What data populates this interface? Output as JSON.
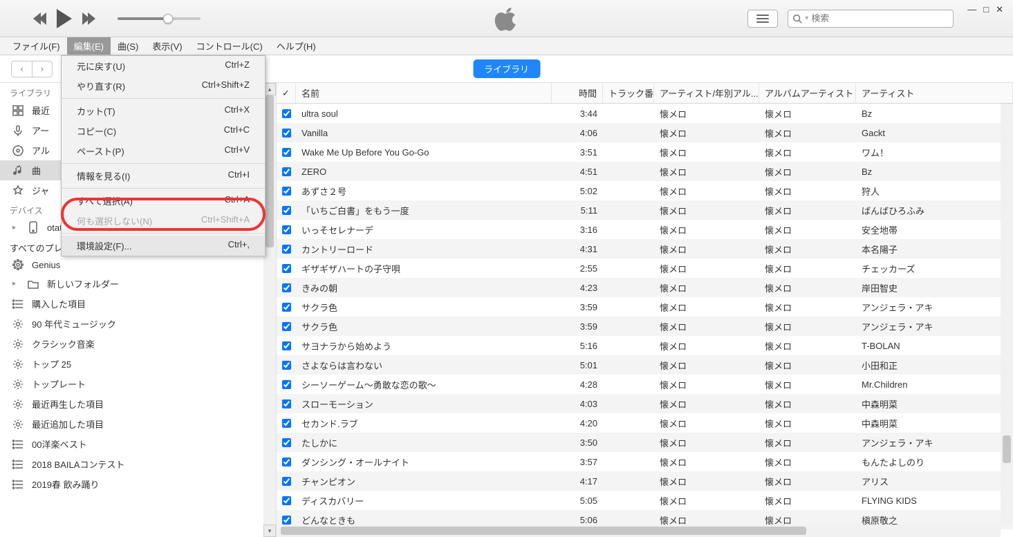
{
  "search_placeholder": "検索",
  "menubar": [
    "ファイル(F)",
    "編集(E)",
    "曲(S)",
    "表示(V)",
    "コントロール(C)",
    "ヘルプ(H)"
  ],
  "dropdown": [
    {
      "label": "元に戻す(U)",
      "short": "Ctrl+Z"
    },
    {
      "label": "やり直す(R)",
      "short": "Ctrl+Shift+Z"
    },
    {
      "sep": true
    },
    {
      "label": "カット(T)",
      "short": "Ctrl+X"
    },
    {
      "label": "コピー(C)",
      "short": "Ctrl+C"
    },
    {
      "label": "ペースト(P)",
      "short": "Ctrl+V"
    },
    {
      "sep": true
    },
    {
      "label": "情報を見る(I)",
      "short": "Ctrl+I"
    },
    {
      "sep": true
    },
    {
      "label": "すべて選択(A)",
      "short": "Ctrl+A"
    },
    {
      "label": "何も選択しない(N)",
      "short": "Ctrl+Shift+A",
      "disabled": true
    },
    {
      "sep": true
    },
    {
      "label": "環境設定(F)...",
      "short": "Ctrl+,",
      "hover": true
    }
  ],
  "library_pill": "ライブラリ",
  "sidebar": {
    "section_library": "ライブラリ",
    "items_library": [
      {
        "icon": "grid",
        "label": "最近"
      },
      {
        "icon": "mic",
        "label": "アー"
      },
      {
        "icon": "disc",
        "label": "アル"
      },
      {
        "icon": "note",
        "label": "曲",
        "selected": true
      },
      {
        "icon": "genre",
        "label": "ジャ"
      }
    ],
    "section_device": "デバイス",
    "items_device": [
      {
        "icon": "phone",
        "label": "otata iPhone",
        "disclose": true
      }
    ],
    "section_playlists": "すべてのプレイリスト",
    "items_playlists": [
      {
        "icon": "genius",
        "label": "Genius"
      },
      {
        "icon": "folder",
        "label": "新しいフォルダー",
        "disclose": true
      },
      {
        "icon": "list",
        "label": "購入した項目"
      },
      {
        "icon": "gear",
        "label": "90 年代ミュージック"
      },
      {
        "icon": "gear",
        "label": "クラシック音楽"
      },
      {
        "icon": "gear",
        "label": "トップ 25"
      },
      {
        "icon": "gear",
        "label": "トップレート"
      },
      {
        "icon": "gear",
        "label": "最近再生した項目"
      },
      {
        "icon": "gear",
        "label": "最近追加した項目"
      },
      {
        "icon": "list",
        "label": "00洋楽ベスト"
      },
      {
        "icon": "list",
        "label": "2018 BAILAコンテスト"
      },
      {
        "icon": "list",
        "label": "2019春 飲み踊り"
      }
    ]
  },
  "columns": {
    "name": "名前",
    "time": "時間",
    "track": "トラック番号",
    "album": "アーティスト/年別アル...",
    "album_artist": "アルバムアーティスト",
    "artist": "アーティスト"
  },
  "rows": [
    {
      "name": "ultra soul",
      "time": "3:44",
      "album": "懐メロ",
      "aa": "懐メロ",
      "artist": "Bz"
    },
    {
      "name": "Vanilla",
      "time": "4:06",
      "album": "懐メロ",
      "aa": "懐メロ",
      "artist": "Gackt"
    },
    {
      "name": "Wake Me Up Before You Go-Go",
      "time": "3:51",
      "album": "懐メロ",
      "aa": "懐メロ",
      "artist": "ワム！"
    },
    {
      "name": "ZERO",
      "time": "4:51",
      "album": "懐メロ",
      "aa": "懐メロ",
      "artist": "Bz"
    },
    {
      "name": "あずさ２号",
      "time": "5:02",
      "album": "懐メロ",
      "aa": "懐メロ",
      "artist": "狩人"
    },
    {
      "name": "「いちご白書」をもう一度",
      "time": "5:11",
      "album": "懐メロ",
      "aa": "懐メロ",
      "artist": "ばんばひろふみ"
    },
    {
      "name": "いっそセレナーデ",
      "time": "3:16",
      "album": "懐メロ",
      "aa": "懐メロ",
      "artist": "安全地帯"
    },
    {
      "name": "カントリーロード",
      "time": "4:31",
      "album": "懐メロ",
      "aa": "懐メロ",
      "artist": "本名陽子"
    },
    {
      "name": "ギザギザハートの子守唄",
      "time": "2:55",
      "album": "懐メロ",
      "aa": "懐メロ",
      "artist": "チェッカーズ"
    },
    {
      "name": "きみの朝",
      "time": "4:23",
      "album": "懐メロ",
      "aa": "懐メロ",
      "artist": "岸田智史"
    },
    {
      "name": "サクラ色",
      "time": "3:59",
      "album": "懐メロ",
      "aa": "懐メロ",
      "artist": "アンジェラ・アキ"
    },
    {
      "name": "サクラ色",
      "time": "3:59",
      "album": "懐メロ",
      "aa": "懐メロ",
      "artist": "アンジェラ・アキ"
    },
    {
      "name": "サヨナラから始めよう",
      "time": "5:16",
      "album": "懐メロ",
      "aa": "懐メロ",
      "artist": "T-BOLAN"
    },
    {
      "name": "さよならは言わない",
      "time": "5:01",
      "album": "懐メロ",
      "aa": "懐メロ",
      "artist": "小田和正"
    },
    {
      "name": "シーソーゲーム～勇敢な恋の歌～",
      "time": "4:28",
      "album": "懐メロ",
      "aa": "懐メロ",
      "artist": "Mr.Children"
    },
    {
      "name": "スローモーション",
      "time": "4:03",
      "album": "懐メロ",
      "aa": "懐メロ",
      "artist": "中森明菜"
    },
    {
      "name": "セカンド.ラブ",
      "time": "4:20",
      "album": "懐メロ",
      "aa": "懐メロ",
      "artist": "中森明菜"
    },
    {
      "name": "たしかに",
      "time": "3:50",
      "album": "懐メロ",
      "aa": "懐メロ",
      "artist": "アンジェラ・アキ"
    },
    {
      "name": "ダンシング・オールナイト",
      "time": "3:57",
      "album": "懐メロ",
      "aa": "懐メロ",
      "artist": "もんたよしのり"
    },
    {
      "name": "チャンピオン",
      "time": "4:17",
      "album": "懐メロ",
      "aa": "懐メロ",
      "artist": "アリス"
    },
    {
      "name": "ディスカバリー",
      "time": "5:05",
      "album": "懐メロ",
      "aa": "懐メロ",
      "artist": "FLYING KIDS"
    },
    {
      "name": "どんなときも",
      "time": "5:06",
      "album": "懐メロ",
      "aa": "懐メロ",
      "artist": "槇原敬之"
    }
  ]
}
